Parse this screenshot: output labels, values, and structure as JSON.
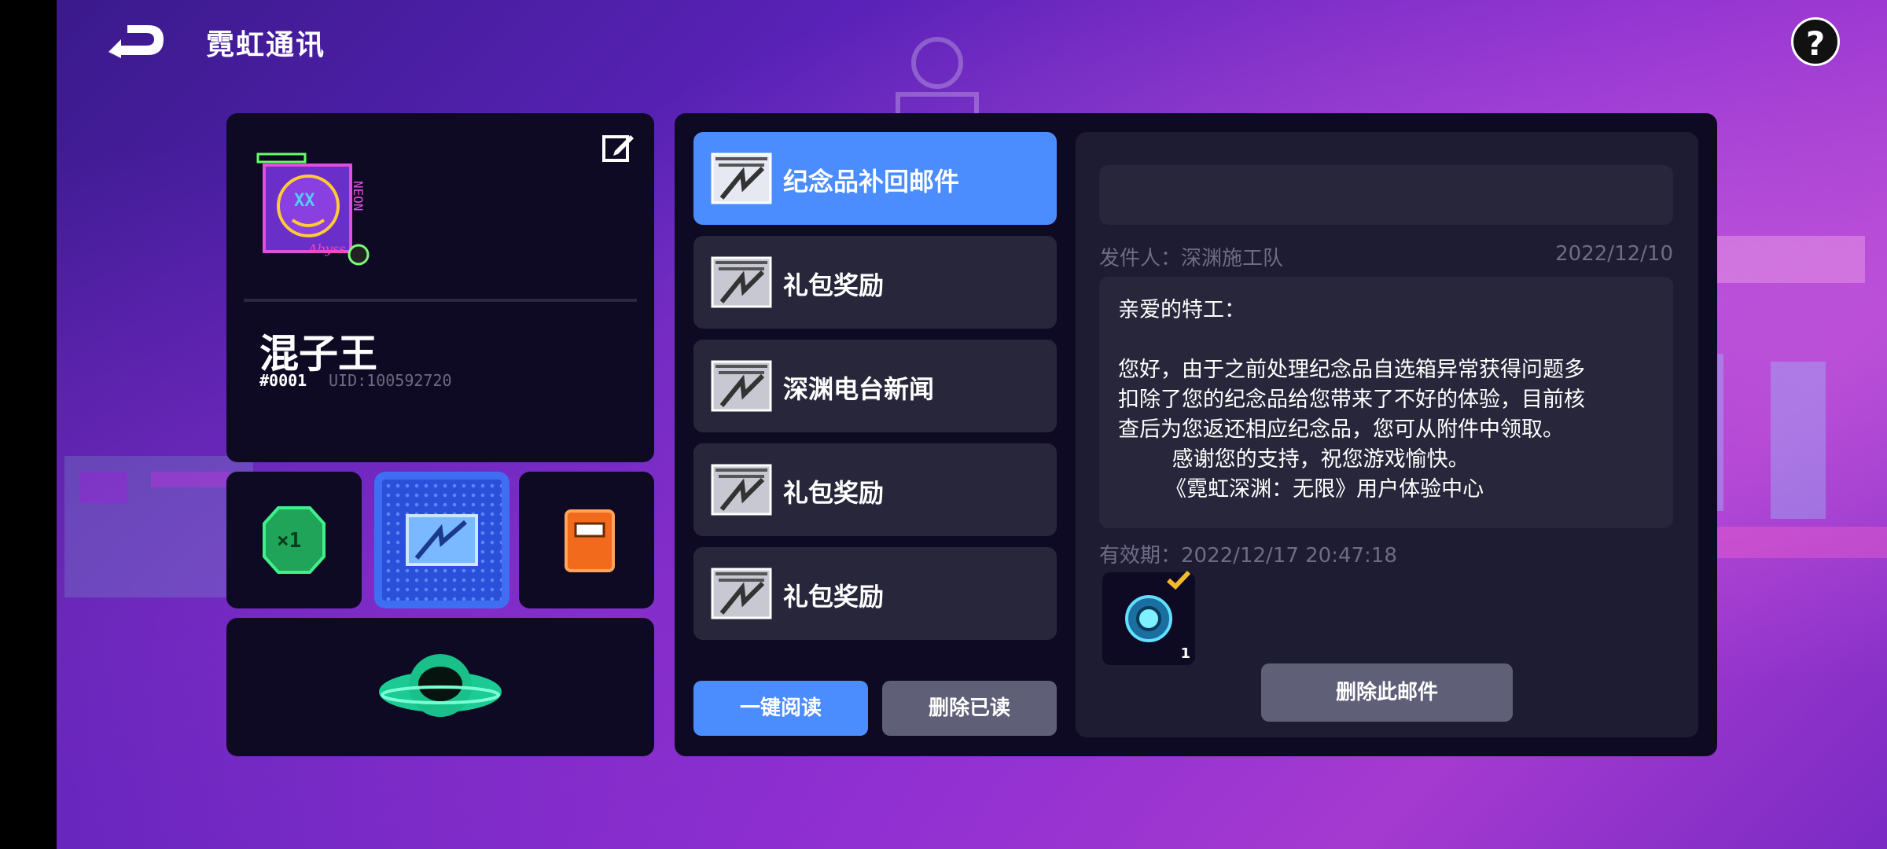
{
  "header": {
    "title": "霓虹通讯",
    "help_label": "?"
  },
  "profile": {
    "name": "混子王",
    "id_tag": "#0001",
    "uid": "UID:100592720",
    "avatar_text": "NEON Abyss"
  },
  "mail_list": [
    {
      "label": "纪念品补回邮件",
      "active": true
    },
    {
      "label": "礼包奖励",
      "active": false
    },
    {
      "label": "深渊电台新闻",
      "active": false
    },
    {
      "label": "礼包奖励",
      "active": false
    },
    {
      "label": "礼包奖励",
      "active": false
    }
  ],
  "buttons": {
    "read_all": "一键阅读",
    "delete_read": "删除已读",
    "delete_this": "删除此邮件"
  },
  "mail_detail": {
    "sender": "发件人：深渊施工队",
    "date": "2022/12/10",
    "body": [
      "亲爱的特工：",
      "",
      "您好，由于之前处理纪念品自选箱异常获得问题多",
      "扣除了您的纪念品给您带来了不好的体验，目前核",
      "查后为您返还相应纪念品，您可从附件中领取。",
      "        感谢您的支持，祝您游戏愉快。",
      "       《霓虹深渊：无限》用户体验中心"
    ],
    "expire": "有效期：2022/12/17 20:47:18",
    "attachment_count": "1"
  },
  "colors": {
    "accent": "#4b8cff",
    "panel": "#0f0a23",
    "muted": "#6e6c86"
  }
}
